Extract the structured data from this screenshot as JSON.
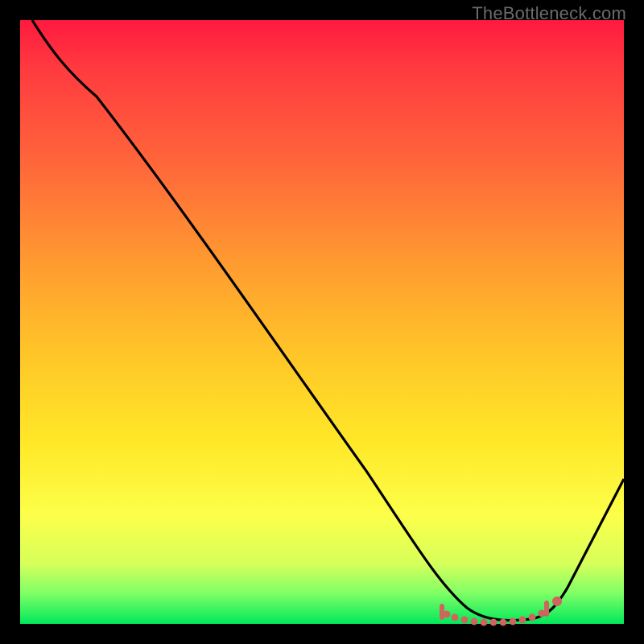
{
  "watermark": "TheBottleneck.com",
  "colors": {
    "curve_stroke": "#000000",
    "marker_fill": "#d0645e",
    "marker_stroke": "#d0645e"
  },
  "chart_data": {
    "type": "line",
    "title": "",
    "xlabel": "",
    "ylabel": "",
    "xlim": [
      0,
      100
    ],
    "ylim": [
      0,
      100
    ],
    "x": [
      2,
      8,
      15,
      25,
      35,
      45,
      55,
      62,
      68,
      72,
      76,
      80,
      84,
      88,
      100
    ],
    "values": [
      100,
      95,
      89,
      77,
      65,
      52,
      39,
      28,
      17,
      8,
      3,
      1,
      1,
      3,
      25
    ],
    "flat_region": {
      "x_start": 70,
      "x_end": 88,
      "y": 2
    },
    "marker_point": {
      "x": 88,
      "y": 4
    }
  }
}
